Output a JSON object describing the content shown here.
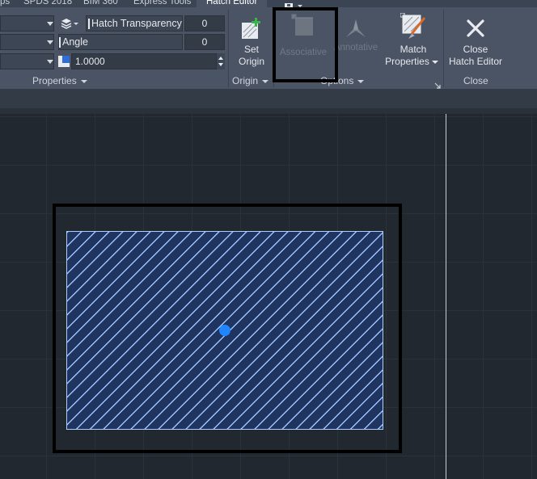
{
  "tabs": [
    {
      "label": "ps"
    },
    {
      "label": "SPDS 2018"
    },
    {
      "label": "BIM 360"
    },
    {
      "label": "Express Tools"
    },
    {
      "label": "Hatch Editor"
    }
  ],
  "properties": {
    "panel_title": "Properties",
    "rows": [
      {
        "label": "Hatch Transparency",
        "value": "0"
      },
      {
        "label": "Angle",
        "value": "0"
      },
      {
        "label": "",
        "value": "1.0000"
      }
    ]
  },
  "origin": {
    "panel_title": "Origin",
    "set_origin_line1": "Set",
    "set_origin_line2": "Origin"
  },
  "options": {
    "panel_title": "Options",
    "associative_label": "Associative",
    "annotative_label": "Annotative",
    "match_line1": "Match",
    "match_line2": "Properties"
  },
  "close": {
    "panel_title": "Close",
    "close_line1": "Close",
    "close_line2": "Hatch Editor"
  },
  "colors": {
    "ribbon": "#4a5465",
    "canvas": "#212830",
    "hatch_line": "#9ec2ff",
    "grip": "#1f86ff",
    "highlight": "#000000"
  }
}
